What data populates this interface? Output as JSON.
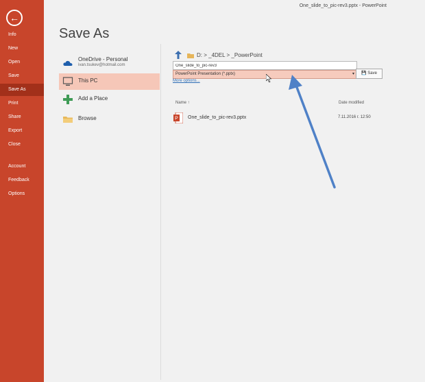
{
  "title_bar": {
    "filename": "One_slide_to_pic-rev3.pptx",
    "separator": "-",
    "app": "PowerPoint"
  },
  "nav": {
    "back_icon": "back-arrow-icon",
    "items": [
      {
        "label": "Info"
      },
      {
        "label": "New"
      },
      {
        "label": "Open"
      },
      {
        "label": "Save"
      },
      {
        "label": "Save As",
        "active": true
      },
      {
        "label": "Print"
      },
      {
        "label": "Share"
      },
      {
        "label": "Export"
      },
      {
        "label": "Close"
      },
      {
        "label": "Account"
      },
      {
        "label": "Feedback"
      },
      {
        "label": "Options"
      }
    ]
  },
  "page": {
    "heading": "Save As"
  },
  "locations": [
    {
      "label": "OneDrive - Personal",
      "sub": "ivan.tsukev@hotmail.com",
      "icon": "cloud-icon"
    },
    {
      "label": "This PC",
      "icon": "computer-icon",
      "active": true
    },
    {
      "label": "Add a Place",
      "icon": "plus-icon"
    },
    {
      "label": "Browse",
      "icon": "folder-icon"
    }
  ],
  "path": {
    "breadcrumb": "D: > _4DEL > _PowerPoint"
  },
  "file_name": {
    "value": "One_slide_to_pic-rev3"
  },
  "file_type": {
    "value": "PowerPoint Presentation (*.pptx)",
    "caret": "▾"
  },
  "save_button": {
    "label": "Save"
  },
  "more_options": "More options...",
  "file_list": {
    "columns": {
      "name": "Name ↑",
      "date": "Date modified"
    },
    "rows": [
      {
        "name": "One_slide_to_pic-rev3.pptx",
        "date": "7.11.2016 г. 12:50"
      }
    ]
  },
  "colors": {
    "nav_bg": "#c8452b",
    "nav_active": "#a2301a",
    "location_active": "#f6c7b8",
    "file_type_bg": "#f6cbbd",
    "annotation_arrow": "#4f81c7",
    "link": "#2b6cb5"
  }
}
